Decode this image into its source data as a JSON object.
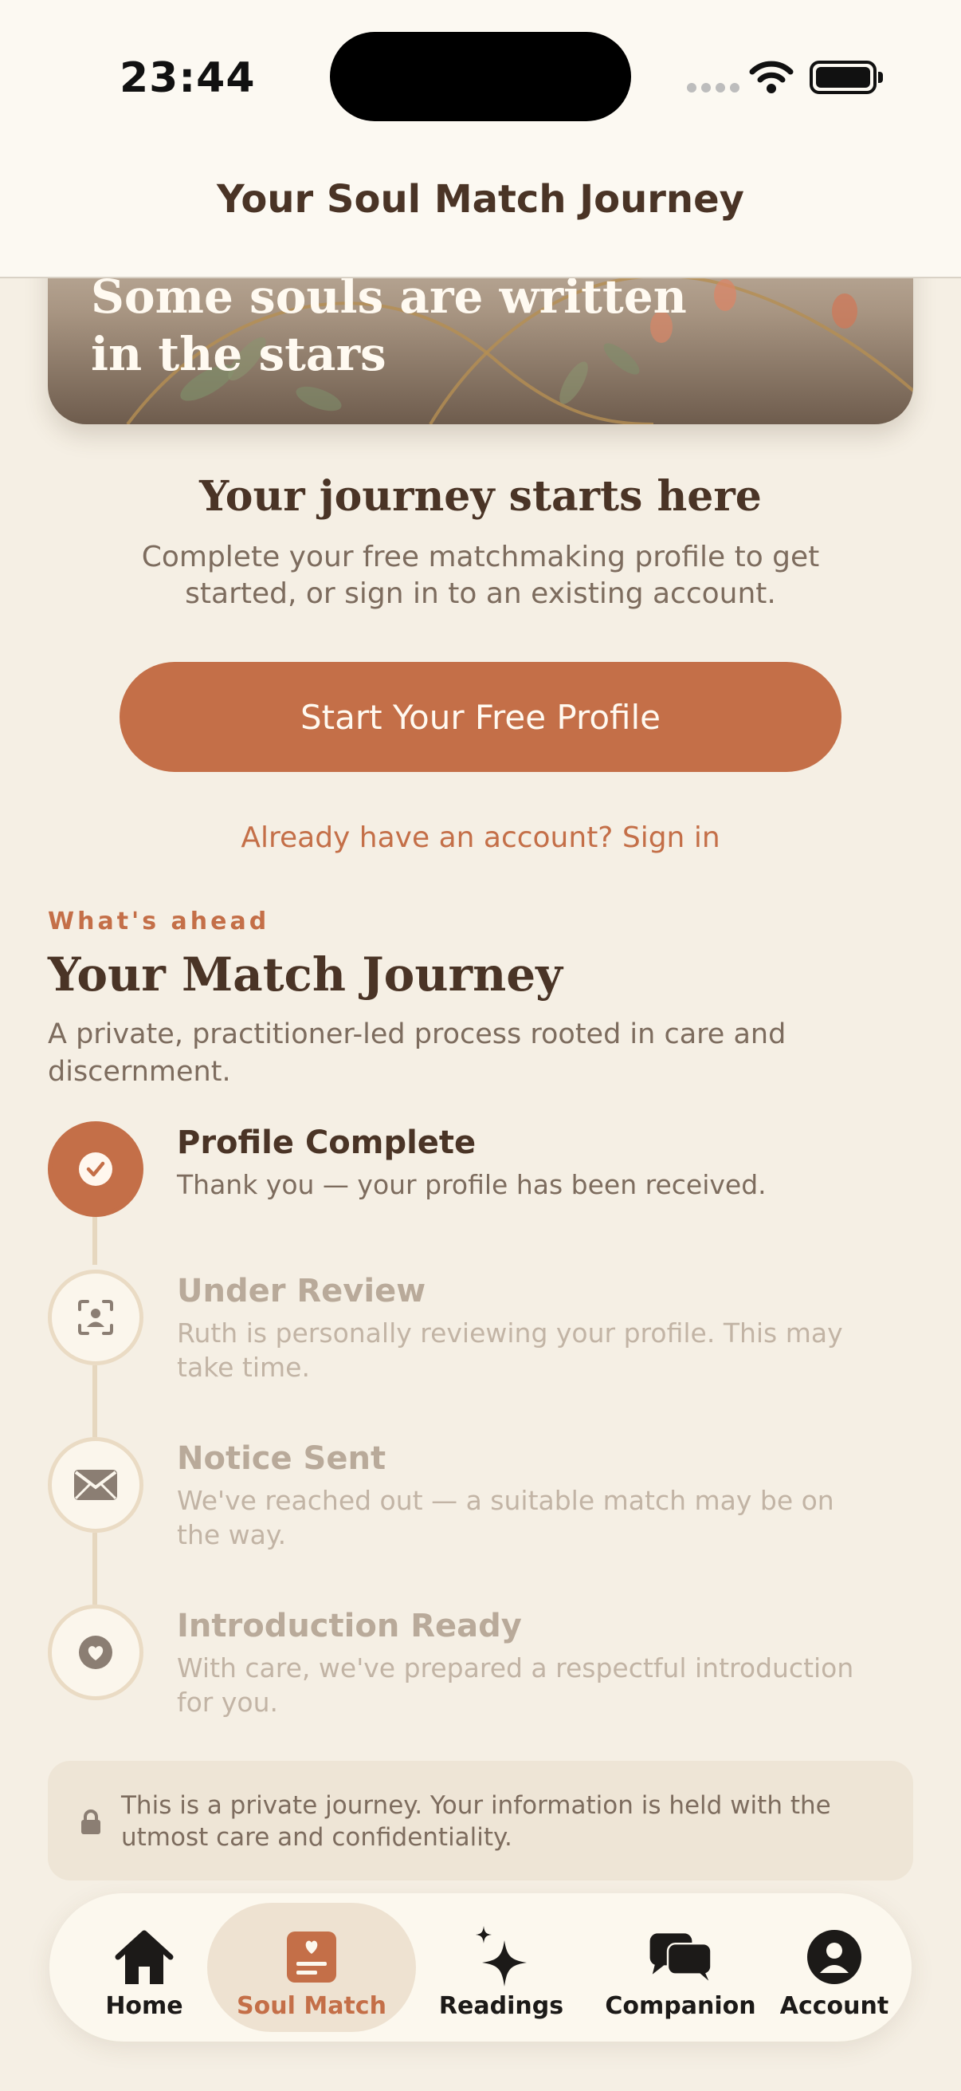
{
  "status_bar": {
    "time": "23:44"
  },
  "header": {
    "title": "Your Soul Match Journey"
  },
  "hero": {
    "title": "Some souls are written in the stars"
  },
  "intro": {
    "title": "Your journey starts here",
    "subtitle_line1": "Complete your free matchmaking profile to get",
    "subtitle_line2": "started, or sign in to an existing account.",
    "primary_button": "Start Your Free Profile",
    "signin_link": "Already have an account? Sign in"
  },
  "section": {
    "eyebrow": "What's ahead",
    "title": "Your Match Journey",
    "subtitle": "A private, practitioner-led process rooted in care and discernment."
  },
  "steps": [
    {
      "title": "Profile Complete",
      "desc": "Thank you — your profile has been received.",
      "state": "complete",
      "icon": "check-icon"
    },
    {
      "title": "Under Review",
      "desc": "Ruth is personally reviewing your profile. This may take time.",
      "state": "pending",
      "icon": "person-scan-icon"
    },
    {
      "title": "Notice Sent",
      "desc": "We've reached out — a suitable match may be on the way.",
      "state": "pending",
      "icon": "envelope-icon"
    },
    {
      "title": "Introduction Ready",
      "desc": "With care, we've prepared a respectful introduction for you.",
      "state": "pending",
      "icon": "heart-icon"
    }
  ],
  "privacy": {
    "text": "This is a private journey. Your information is held with the utmost care and confidentiality."
  },
  "tabs": [
    {
      "label": "Home",
      "icon": "home-icon"
    },
    {
      "label": "Soul Match",
      "icon": "heart-card-icon",
      "active": true
    },
    {
      "label": "Readings",
      "icon": "sparkles-icon"
    },
    {
      "label": "Companion",
      "icon": "chat-bubbles-icon"
    },
    {
      "label": "Account",
      "icon": "person-circle-icon"
    }
  ],
  "colors": {
    "accent": "#c46f48",
    "background": "#f5efe4",
    "text": "#4a3426",
    "muted": "#7d6c5e"
  }
}
